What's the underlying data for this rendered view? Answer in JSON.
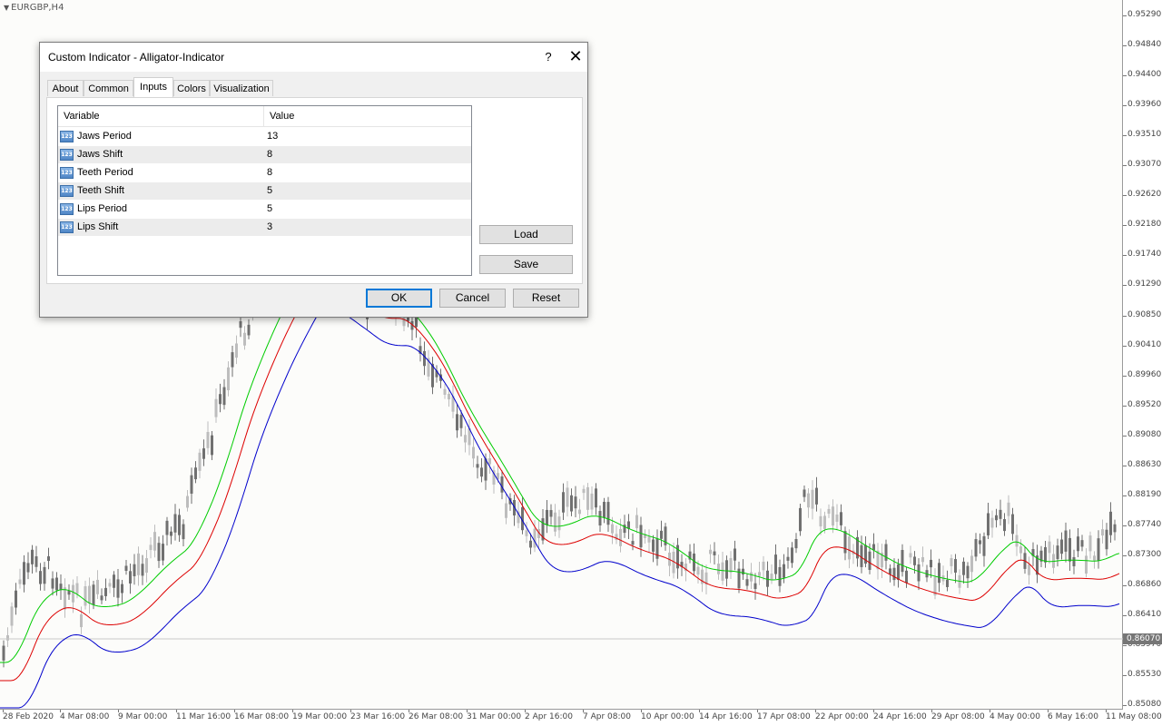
{
  "chart": {
    "symbol": "EURGBP,H4",
    "current_price": "0.86070",
    "price_labels": [
      "0.95290",
      "0.94840",
      "0.94400",
      "0.93960",
      "0.93510",
      "0.93070",
      "0.92620",
      "0.92180",
      "0.91740",
      "0.91290",
      "0.90850",
      "0.90410",
      "0.89960",
      "0.89520",
      "0.89080",
      "0.88630",
      "0.88190",
      "0.87740",
      "0.87300",
      "0.86860",
      "0.86410",
      "0.85970",
      "0.85530",
      "0.85080"
    ],
    "time_labels": [
      "28 Feb 2020",
      "4 Mar 08:00",
      "9 Mar 00:00",
      "11 Mar 16:00",
      "16 Mar 08:00",
      "19 Mar 00:00",
      "23 Mar 16:00",
      "26 Mar 08:00",
      "31 Mar 00:00",
      "2 Apr 16:00",
      "7 Apr 08:00",
      "10 Apr 00:00",
      "14 Apr 16:00",
      "17 Apr 08:00",
      "22 Apr 00:00",
      "24 Apr 16:00",
      "29 Apr 08:00",
      "4 May 00:00",
      "6 May 16:00",
      "11 May 08:00"
    ],
    "colors": {
      "jaws": "#0000cc",
      "teeth": "#dd0000",
      "lips": "#00cc00",
      "candle_up": "#bdbdbd",
      "candle_down": "#707070"
    }
  },
  "dialog": {
    "title": "Custom Indicator - Alligator-Indicator",
    "help_label": "?",
    "close_label": "✕",
    "tabs": [
      "About",
      "Common",
      "Inputs",
      "Colors",
      "Visualization"
    ],
    "active_tab": "Inputs",
    "table": {
      "col_variable": "Variable",
      "col_value": "Value",
      "type_icon": "123",
      "rows": [
        {
          "name": "Jaws Period",
          "value": "13"
        },
        {
          "name": "Jaws Shift",
          "value": "8"
        },
        {
          "name": "Teeth Period",
          "value": "8"
        },
        {
          "name": "Teeth Shift",
          "value": "5"
        },
        {
          "name": "Lips Period",
          "value": "5"
        },
        {
          "name": "Lips Shift",
          "value": "3"
        }
      ]
    },
    "buttons": {
      "load": "Load",
      "save": "Save",
      "ok": "OK",
      "cancel": "Cancel",
      "reset": "Reset"
    }
  }
}
